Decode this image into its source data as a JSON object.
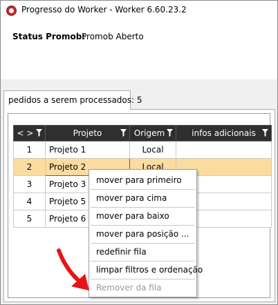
{
  "window": {
    "title": "Progresso do Worker  -  Worker 6.60.23.2"
  },
  "status": {
    "label": "Status Promob:",
    "value": "Promob Aberto"
  },
  "tab": {
    "label": "pedidos a serem processados: 5"
  },
  "grid": {
    "columns": [
      {
        "label": "< >"
      },
      {
        "label": "Projeto"
      },
      {
        "label": "Origem"
      },
      {
        "label": "infos adicionais"
      }
    ],
    "rows": [
      {
        "num": "1",
        "projeto": "Projeto 1",
        "origem": "Local",
        "infos": ""
      },
      {
        "num": "2",
        "projeto": "Projeto 2",
        "origem": "Local",
        "infos": ""
      },
      {
        "num": "3",
        "projeto": "Projeto 3",
        "origem": "",
        "infos": ""
      },
      {
        "num": "4",
        "projeto": "Projeto 5",
        "origem": "",
        "infos": ""
      },
      {
        "num": "5",
        "projeto": "Projeto 6",
        "origem": "",
        "infos": ""
      }
    ],
    "selected_row": 1,
    "selected_color": "#fbdca0",
    "header_color": "#2f2f2f"
  },
  "context_menu": {
    "items": [
      {
        "label": "mover para primeiro",
        "enabled": true
      },
      {
        "label": "mover para cima",
        "enabled": true
      },
      {
        "label": "mover para baixo",
        "enabled": true
      },
      {
        "label": "mover para posição ...",
        "enabled": true
      },
      {
        "label": "redefinir fila",
        "enabled": true
      },
      {
        "label": "limpar filtros e ordenação",
        "enabled": true
      },
      {
        "label": "Remover da fila",
        "enabled": false
      }
    ]
  },
  "annotation": {
    "arrow_color": "#e8141b",
    "icon": "red-arrow-icon"
  }
}
